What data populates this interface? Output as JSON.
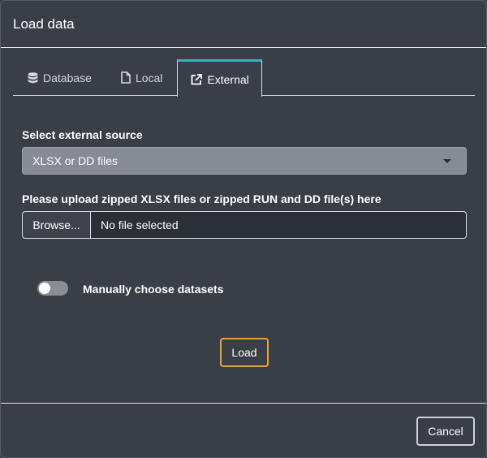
{
  "dialog": {
    "title": "Load data"
  },
  "tabs": [
    {
      "label": "Database",
      "icon": "database-icon",
      "active": false
    },
    {
      "label": "Local",
      "icon": "file-icon",
      "active": false
    },
    {
      "label": "External",
      "icon": "external-link-icon",
      "active": true
    }
  ],
  "external_source": {
    "label": "Select external source",
    "selected": "XLSX or DD files"
  },
  "upload": {
    "label": "Please upload zipped XLSX files or zipped RUN and DD file(s) here",
    "browse_label": "Browse...",
    "file_status": "No file selected"
  },
  "manual_datasets": {
    "label": "Manually choose datasets",
    "enabled": false
  },
  "actions": {
    "load_label": "Load",
    "cancel_label": "Cancel"
  },
  "colors": {
    "background": "#393e47",
    "active_tab_accent": "#2ab7c0",
    "load_border": "#e8a63a",
    "select_bg": "#878b94"
  }
}
